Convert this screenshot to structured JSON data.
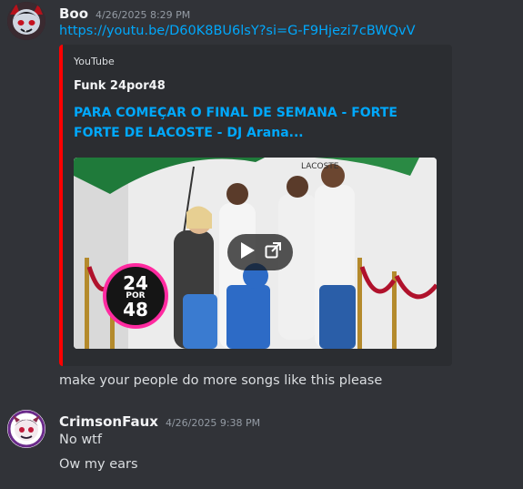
{
  "messages": [
    {
      "username": "Boo",
      "timestamp": "4/26/2025 8:29 PM",
      "link": "https://youtu.be/D60K8BU6lsY?si=G-F9Hjezi7cBWQvV",
      "embed": {
        "provider": "YouTube",
        "author": "Funk 24por48",
        "title": "PARA COMEÇAR O FINAL DE SEMANA - FORTE FORTE DE LACOSTE - DJ Arana...",
        "thumbnail": {
          "logo_line1": "24",
          "logo_line2": "POR",
          "logo_line3": "48",
          "sign_text": "LACOSTE"
        },
        "accent_color": "#ff0000"
      },
      "text": "make your people do more songs like this please"
    },
    {
      "username": "CrimsonFaux",
      "timestamp": "4/26/2025 9:38 PM",
      "lines": [
        "No wtf",
        "Ow my ears"
      ]
    }
  ],
  "icons": {
    "play": "play-icon",
    "external": "external-link-icon"
  },
  "colors": {
    "background": "#313338",
    "embed_background": "#2b2d31",
    "link": "#00a8fc",
    "youtube_red": "#ff0000"
  }
}
